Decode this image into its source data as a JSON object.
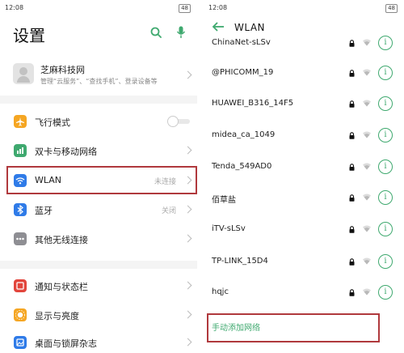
{
  "left": {
    "status": {
      "time": "12:08",
      "battery": "48"
    },
    "title": "设置",
    "account": {
      "name": "芝麻科技网",
      "subtitle": "管理“云服务”、“查找手机”、登录设备等"
    },
    "rows": [
      {
        "label": "飞行模式",
        "icon": "airplane-icon",
        "color": "#f5a623"
      },
      {
        "label": "双卡与移动网络",
        "icon": "sim-icon",
        "color": "#3fa96f"
      },
      {
        "label": "WLAN",
        "value": "未连接",
        "icon": "wifi-icon",
        "color": "#2f7be8"
      },
      {
        "label": "蓝牙",
        "value": "关闭",
        "icon": "bluetooth-icon",
        "color": "#2f7be8"
      },
      {
        "label": "其他无线连接",
        "icon": "more-icon",
        "color": "#8e8e93"
      },
      {
        "label": "通知与状态栏",
        "icon": "notification-icon",
        "color": "#e2453c"
      },
      {
        "label": "显示与亮度",
        "icon": "brightness-icon",
        "color": "#f5a623"
      },
      {
        "label": "桌面与锁屏杂志",
        "icon": "wallpaper-icon",
        "color": "#2f7be8"
      }
    ]
  },
  "right": {
    "status": {
      "time": "12:08",
      "battery": "48"
    },
    "title": "WLAN",
    "networks": [
      {
        "ssid": "ChinaNet-sLSv"
      },
      {
        "ssid": "@PHICOMM_19"
      },
      {
        "ssid": "HUAWEI_B316_14F5"
      },
      {
        "ssid": "midea_ca_1049"
      },
      {
        "ssid": "Tenda_549AD0"
      },
      {
        "ssid": "佰草盐"
      },
      {
        "ssid": "iTV-sLSv"
      },
      {
        "ssid": "TP-LINK_15D4"
      },
      {
        "ssid": "hqjc"
      }
    ],
    "add_network": "手动添加网络",
    "info_glyph": "i"
  },
  "colors": {
    "accent": "#3fa96f",
    "highlight": "#b0393d"
  }
}
